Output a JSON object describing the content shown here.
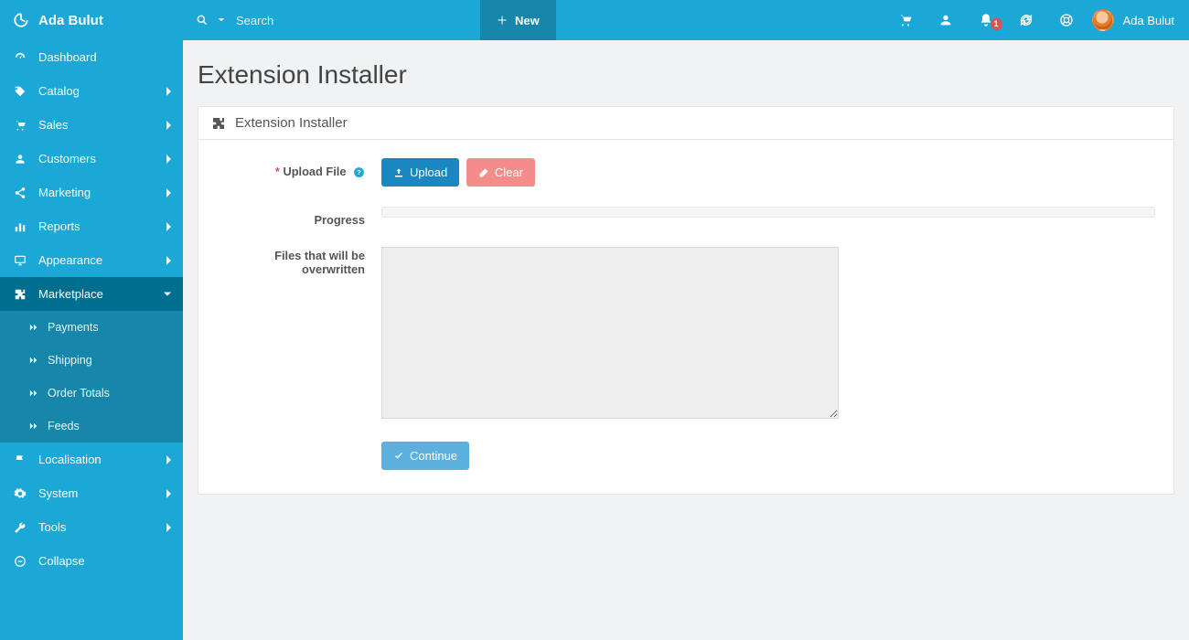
{
  "brand": {
    "name": "Ada Bulut"
  },
  "topbar": {
    "search_placeholder": "Search",
    "new_label": "New",
    "notification_count": "1",
    "user_name": "Ada Bulut"
  },
  "sidebar": {
    "items": [
      {
        "label": "Dashboard",
        "icon": "dashboard",
        "expandable": false
      },
      {
        "label": "Catalog",
        "icon": "tag",
        "expandable": true
      },
      {
        "label": "Sales",
        "icon": "cart",
        "expandable": true
      },
      {
        "label": "Customers",
        "icon": "user",
        "expandable": true
      },
      {
        "label": "Marketing",
        "icon": "share",
        "expandable": true
      },
      {
        "label": "Reports",
        "icon": "bars",
        "expandable": true
      },
      {
        "label": "Appearance",
        "icon": "monitor",
        "expandable": true
      },
      {
        "label": "Marketplace",
        "icon": "puzzle",
        "expandable": true,
        "open": true,
        "children": [
          {
            "label": "Payments"
          },
          {
            "label": "Shipping"
          },
          {
            "label": "Order Totals"
          },
          {
            "label": "Feeds"
          }
        ]
      },
      {
        "label": "Localisation",
        "icon": "flag",
        "expandable": true
      },
      {
        "label": "System",
        "icon": "cog",
        "expandable": true
      },
      {
        "label": "Tools",
        "icon": "wrench",
        "expandable": true
      },
      {
        "label": "Collapse",
        "icon": "collapse",
        "expandable": false
      }
    ]
  },
  "page": {
    "title": "Extension Installer",
    "panel_title": "Extension Installer"
  },
  "form": {
    "upload_label": "Upload File",
    "upload_button": "Upload",
    "clear_button": "Clear",
    "progress_label": "Progress",
    "overwrite_label": "Files that will be overwritten",
    "continue_button": "Continue"
  }
}
